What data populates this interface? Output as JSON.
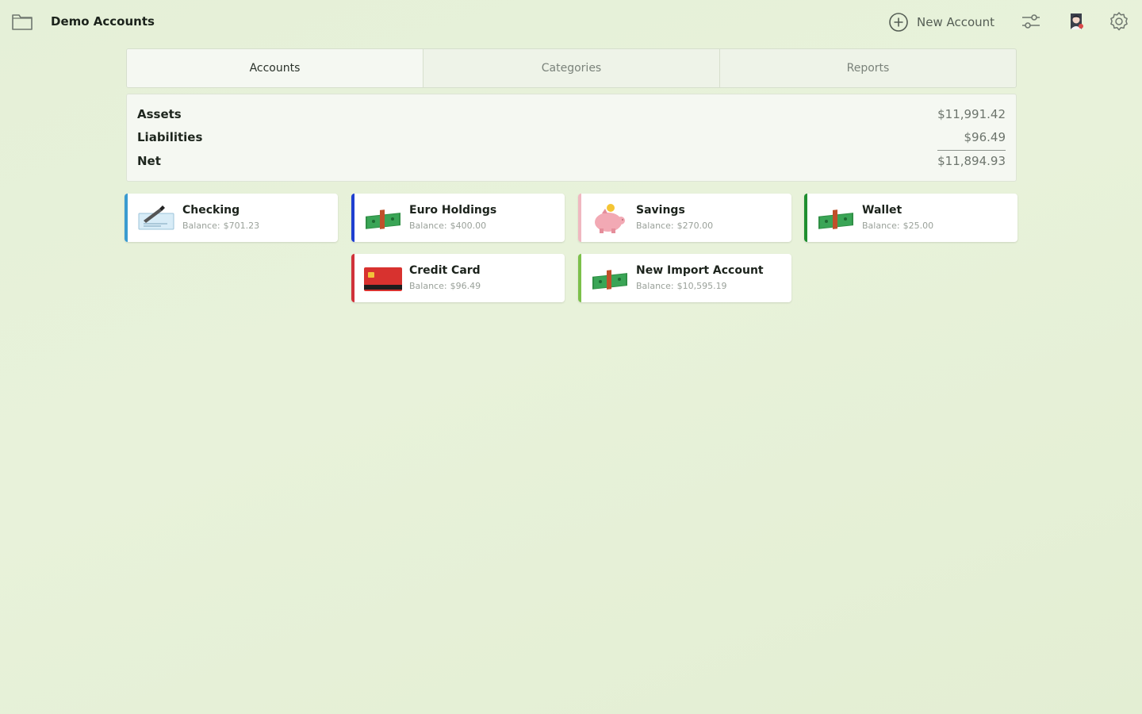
{
  "header": {
    "title": "Demo Accounts",
    "new_account_label": "New Account"
  },
  "tabs": [
    {
      "label": "Accounts",
      "active": true
    },
    {
      "label": "Categories",
      "active": false
    },
    {
      "label": "Reports",
      "active": false
    }
  ],
  "summary": {
    "assets_label": "Assets",
    "assets_value": "$11,991.42",
    "liabilities_label": "Liabilities",
    "liabilities_value": "$96.49",
    "net_label": "Net",
    "net_value": "$11,894.93"
  },
  "balance_label": "Balance:",
  "accounts": [
    {
      "name": "Checking",
      "balance": "$701.23",
      "accent": "#3a9bd0",
      "icon": "check-icon"
    },
    {
      "name": "Euro Holdings",
      "balance": "$400.00",
      "accent": "#1f3fd0",
      "icon": "cash-icon"
    },
    {
      "name": "Savings",
      "balance": "$270.00",
      "accent": "#f0b8c0",
      "icon": "piggy-bank-icon"
    },
    {
      "name": "Wallet",
      "balance": "$25.00",
      "accent": "#1f8f2f",
      "icon": "cash-icon"
    },
    {
      "name": "Credit Card",
      "balance": "$96.49",
      "accent": "#d0323a",
      "icon": "credit-card-icon"
    },
    {
      "name": "New Import Account",
      "balance": "$10,595.19",
      "accent": "#7cc04a",
      "icon": "cash-icon"
    }
  ]
}
